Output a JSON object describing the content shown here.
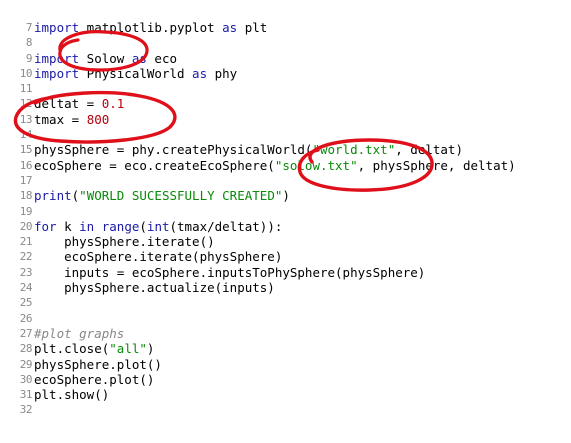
{
  "editor": {
    "lines": [
      {
        "num": "7",
        "segs": [
          {
            "t": "import",
            "c": "kw"
          },
          {
            "t": " matplotlib.pyplot ",
            "c": ""
          },
          {
            "t": "as",
            "c": "kw"
          },
          {
            "t": " plt",
            "c": ""
          }
        ]
      },
      {
        "num": "8",
        "segs": []
      },
      {
        "num": "9",
        "segs": [
          {
            "t": "import",
            "c": "kw"
          },
          {
            "t": " Solow ",
            "c": ""
          },
          {
            "t": "as",
            "c": "kw"
          },
          {
            "t": " eco",
            "c": ""
          }
        ]
      },
      {
        "num": "10",
        "segs": [
          {
            "t": "import",
            "c": "kw"
          },
          {
            "t": " PhysicalWorld ",
            "c": ""
          },
          {
            "t": "as",
            "c": "kw"
          },
          {
            "t": " phy",
            "c": ""
          }
        ]
      },
      {
        "num": "11",
        "segs": []
      },
      {
        "num": "12",
        "segs": [
          {
            "t": "deltat = ",
            "c": ""
          },
          {
            "t": "0.1",
            "c": "num"
          }
        ]
      },
      {
        "num": "13",
        "segs": [
          {
            "t": "tmax = ",
            "c": ""
          },
          {
            "t": "800",
            "c": "num"
          }
        ]
      },
      {
        "num": "14",
        "segs": []
      },
      {
        "num": "15",
        "segs": [
          {
            "t": "physSphere = phy.createPhysicalWorld(",
            "c": ""
          },
          {
            "t": "\"world.txt\"",
            "c": "str"
          },
          {
            "t": ", deltat)",
            "c": ""
          }
        ]
      },
      {
        "num": "16",
        "segs": [
          {
            "t": "ecoSphere = eco.createEcoSphere(",
            "c": ""
          },
          {
            "t": "\"solow.txt\"",
            "c": "str"
          },
          {
            "t": ", physSphere, deltat)",
            "c": ""
          }
        ]
      },
      {
        "num": "17",
        "segs": []
      },
      {
        "num": "18",
        "segs": [
          {
            "t": "print",
            "c": "kw"
          },
          {
            "t": "(",
            "c": ""
          },
          {
            "t": "\"WORLD SUCESSFULLY CREATED\"",
            "c": "str"
          },
          {
            "t": ")",
            "c": ""
          }
        ]
      },
      {
        "num": "19",
        "segs": []
      },
      {
        "num": "20",
        "segs": [
          {
            "t": "for",
            "c": "kw"
          },
          {
            "t": " k ",
            "c": ""
          },
          {
            "t": "in",
            "c": "kw"
          },
          {
            "t": " ",
            "c": ""
          },
          {
            "t": "range",
            "c": "kw"
          },
          {
            "t": "(",
            "c": ""
          },
          {
            "t": "int",
            "c": "kw"
          },
          {
            "t": "(tmax/deltat)):",
            "c": ""
          }
        ]
      },
      {
        "num": "21",
        "segs": [
          {
            "t": "    physSphere.iterate()",
            "c": ""
          }
        ]
      },
      {
        "num": "22",
        "segs": [
          {
            "t": "    ecoSphere.iterate(physSphere)",
            "c": ""
          }
        ]
      },
      {
        "num": "23",
        "segs": [
          {
            "t": "    inputs = ecoSphere.inputsToPhySphere(physSphere)",
            "c": ""
          }
        ]
      },
      {
        "num": "24",
        "segs": [
          {
            "t": "    physSphere.actualize(inputs)",
            "c": ""
          }
        ]
      },
      {
        "num": "25",
        "segs": []
      },
      {
        "num": "26",
        "segs": []
      },
      {
        "num": "27",
        "segs": [
          {
            "t": "#plot graphs",
            "c": "cmt"
          }
        ]
      },
      {
        "num": "28",
        "segs": [
          {
            "t": "plt.close(",
            "c": ""
          },
          {
            "t": "\"all\"",
            "c": "str"
          },
          {
            "t": ")",
            "c": ""
          }
        ]
      },
      {
        "num": "29",
        "segs": [
          {
            "t": "physSphere.plot()",
            "c": ""
          }
        ]
      },
      {
        "num": "30",
        "segs": [
          {
            "t": "ecoSphere.plot()",
            "c": ""
          }
        ]
      },
      {
        "num": "31",
        "segs": [
          {
            "t": "plt.show()",
            "c": ""
          }
        ]
      },
      {
        "num": "32",
        "segs": []
      }
    ]
  },
  "colors": {
    "keyword": "#1a1aa6",
    "string": "#0a8a0a",
    "number": "#b8000a",
    "comment": "#888888",
    "line_number": "#8a8a8a",
    "annotation": "#e0101a"
  },
  "annotations": [
    "circle-around-solow-import",
    "circle-around-deltat-tmax",
    "circle-around-solow-txt"
  ]
}
